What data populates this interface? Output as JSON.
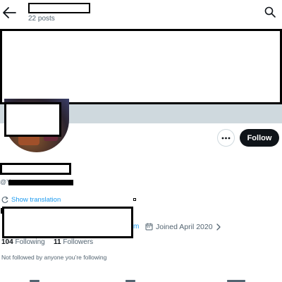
{
  "header": {
    "back_icon": "arrow-left-icon",
    "posts_count": "22 posts",
    "search_icon": "search-icon"
  },
  "profile": {
    "more_icon": "more-horizontal-icon",
    "follow_label": "Follow",
    "handle_prefix": "@Y",
    "translation_icon": "translate-icon",
    "show_translation": "Show translation",
    "website_fragment": "m",
    "calendar_icon": "calendar-icon",
    "joined": "Joined April 2020",
    "chevron_icon": "chevron-right-icon",
    "following_count": "104",
    "following_label": "Following",
    "followers_count": "11",
    "followers_label": "Followers",
    "not_followed": "Not followed by anyone you’re following"
  },
  "colors": {
    "accent": "#1d9bf0",
    "banner_strip": "#cfd9de",
    "follow_bg": "#0f1419",
    "text": "#0f1419",
    "muted": "#536471"
  }
}
